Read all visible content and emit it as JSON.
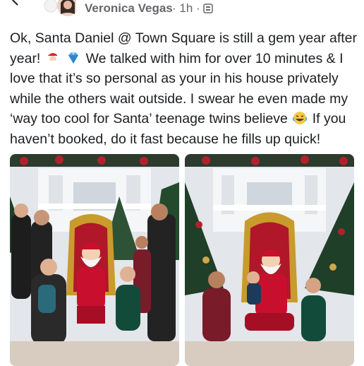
{
  "post": {
    "author": "Veronica Vegas",
    "time": "1h",
    "separator": "·",
    "privacy_icon": "album-icon",
    "text_part1": "Ok, Santa Daniel @ Town Square is still a gem year after year!",
    "text_part2": "We talked with him for over 10 minutes & I love that it’s so personal as your in his house privately while the others wait outside. I swear he even made my ‘way too cool for Santa’ teenage twins believe",
    "text_part3": "If you haven’t booked, do it fast because he fills up quick!",
    "emojis": [
      "santa-emoji",
      "gem-emoji",
      "laughing-emoji"
    ]
  },
  "photos": [
    {
      "name": "photo-family-with-santa",
      "description_icon": "photo"
    },
    {
      "name": "photo-kids-with-santa",
      "description_icon": "photo"
    }
  ],
  "colors": {
    "meta_text": "#65676b",
    "body_text": "#1c1e21",
    "santa_red": "#c8102e",
    "wall": "#e9ecef"
  }
}
